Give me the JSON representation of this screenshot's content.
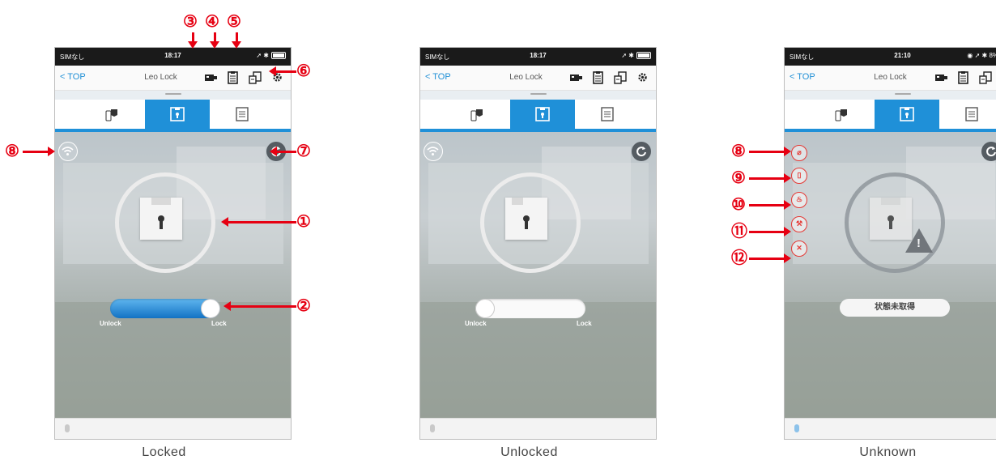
{
  "colors": {
    "accent": "#1f90d8",
    "annotation": "#e60012",
    "warning": "#e53935"
  },
  "common": {
    "back_label": "TOP",
    "title": "Leo Lock",
    "unlock_label": "Unlock",
    "lock_label": "Lock"
  },
  "phones": [
    {
      "caption": "Locked",
      "carrier": "SIMなし",
      "time": "18:17",
      "state": "locked"
    },
    {
      "caption": "Unlocked",
      "carrier": "SIMなし",
      "time": "18:17",
      "state": "unlocked"
    },
    {
      "caption": "Unknown",
      "carrier": "SIMなし",
      "time": "21:10",
      "battery": "8%",
      "state": "unknown",
      "status_text": "状態未取得"
    }
  ],
  "annotations": {
    "n1": "①",
    "n2": "②",
    "n3": "③",
    "n4": "④",
    "n5": "⑤",
    "n6": "⑥",
    "n7": "⑦",
    "n8": "⑧",
    "n9": "⑨",
    "n10": "⑩",
    "n11": "⑪",
    "n12": "⑫"
  },
  "icons": {
    "tabs": [
      "key-phone-icon",
      "lock-tab-icon",
      "list-tab-icon"
    ],
    "nav": [
      "camera-icon",
      "clipboard-icon",
      "share-icon",
      "gear-icon"
    ],
    "status": [
      "wifi-icon",
      "refresh-icon"
    ],
    "alerts": [
      "no-signal-icon",
      "battery-alert-icon",
      "fire-icon",
      "tamper-icon",
      "error-icon"
    ]
  }
}
